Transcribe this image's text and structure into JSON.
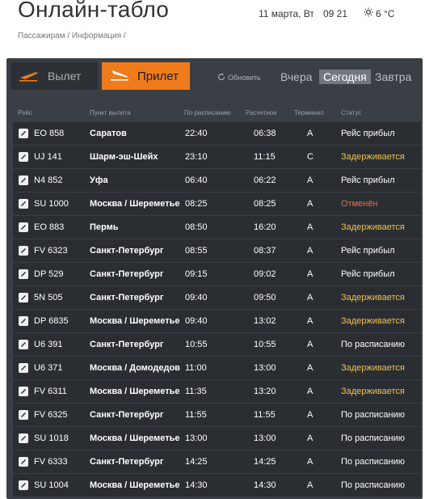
{
  "header": {
    "title": "Онлайн-табло",
    "date": "11 марта, Вт",
    "time": "09 21",
    "weather": "6 °C",
    "breadcrumb": "Пассажирам / Информация /"
  },
  "tabs": {
    "departure": "Вылет",
    "arrival": "Прилет",
    "refresh": "Обновить",
    "yesterday": "Вчера",
    "today": "Сегодня",
    "tomorrow": "Завтра"
  },
  "columns": {
    "flight": "Рейс",
    "origin": "Пункт вылета",
    "scheduled": "По расписанию",
    "estimated": "Расчетное",
    "terminal": "Терминал",
    "status": "Статус"
  },
  "flights": [
    {
      "flight": "EO 858",
      "origin": "Саратов",
      "scheduled": "22:40",
      "estimated": "06:38",
      "terminal": "A",
      "status": "Рейс прибыл",
      "status_type": "arrived",
      "icon": "airline-logo-icon"
    },
    {
      "flight": "UJ 141",
      "origin": "Шарм-эш-Шейх",
      "scheduled": "23:10",
      "estimated": "11:15",
      "terminal": "C",
      "status": "Задерживается",
      "status_type": "delayed",
      "icon": "airline-logo-icon"
    },
    {
      "flight": "N4 852",
      "origin": "Уфа",
      "scheduled": "06:40",
      "estimated": "06:22",
      "terminal": "A",
      "status": "Рейс прибыл",
      "status_type": "arrived",
      "icon": "airline-logo-icon"
    },
    {
      "flight": "SU 1000",
      "origin": "Москва / Шереметьево",
      "scheduled": "08:25",
      "estimated": "08:25",
      "terminal": "A",
      "status": "Отменён",
      "status_type": "cancel",
      "icon": "airline-logo-icon"
    },
    {
      "flight": "EO 883",
      "origin": "Пермь",
      "scheduled": "08:50",
      "estimated": "16:20",
      "terminal": "A",
      "status": "Задерживается",
      "status_type": "delayed",
      "icon": "airline-logo-icon"
    },
    {
      "flight": "FV 6323",
      "origin": "Санкт-Петербург",
      "scheduled": "08:55",
      "estimated": "08:37",
      "terminal": "A",
      "status": "Рейс прибыл",
      "status_type": "arrived",
      "icon": "airline-logo-icon"
    },
    {
      "flight": "DP 529",
      "origin": "Санкт-Петербург",
      "scheduled": "09:15",
      "estimated": "09:02",
      "terminal": "A",
      "status": "Рейс прибыл",
      "status_type": "arrived",
      "icon": "airline-logo-icon"
    },
    {
      "flight": "5N 505",
      "origin": "Санкт-Петербург",
      "scheduled": "09:40",
      "estimated": "09:50",
      "terminal": "A",
      "status": "Задерживается",
      "status_type": "delayed",
      "icon": "airline-logo-icon"
    },
    {
      "flight": "DP 6835",
      "origin": "Москва / Шереметьево",
      "scheduled": "09:40",
      "estimated": "13:02",
      "terminal": "A",
      "status": "Задерживается",
      "status_type": "delayed",
      "icon": "airline-logo-icon"
    },
    {
      "flight": "U6 391",
      "origin": "Санкт-Петербург",
      "scheduled": "10:55",
      "estimated": "10:55",
      "terminal": "A",
      "status": "По расписанию",
      "status_type": "sched",
      "icon": "airline-logo-icon"
    },
    {
      "flight": "U6 371",
      "origin": "Москва / Домодедово",
      "scheduled": "11:00",
      "estimated": "13:00",
      "terminal": "A",
      "status": "Задерживается",
      "status_type": "delayed",
      "icon": "airline-logo-icon"
    },
    {
      "flight": "FV 6311",
      "origin": "Москва / Шереметьево",
      "scheduled": "11:35",
      "estimated": "13:20",
      "terminal": "A",
      "status": "Задерживается",
      "status_type": "delayed",
      "icon": "airline-logo-icon"
    },
    {
      "flight": "FV 6325",
      "origin": "Санкт-Петербург",
      "scheduled": "11:55",
      "estimated": "11:55",
      "terminal": "A",
      "status": "По расписанию",
      "status_type": "sched",
      "icon": "airline-logo-icon"
    },
    {
      "flight": "SU 1018",
      "origin": "Москва / Шереметьево",
      "scheduled": "13:00",
      "estimated": "13:00",
      "terminal": "A",
      "status": "По расписанию",
      "status_type": "sched",
      "icon": "airline-logo-icon"
    },
    {
      "flight": "FV 6333",
      "origin": "Санкт-Петербург",
      "scheduled": "14:25",
      "estimated": "14:25",
      "terminal": "A",
      "status": "По расписанию",
      "status_type": "sched",
      "icon": "airline-logo-icon"
    },
    {
      "flight": "SU 1004",
      "origin": "Москва / Шереметьево",
      "scheduled": "14:30",
      "estimated": "14:30",
      "terminal": "A",
      "status": "По расписанию",
      "status_type": "sched",
      "icon": "airline-logo-icon"
    }
  ],
  "colors": {
    "accent": "#f07b1c",
    "board_bg": "#3a3f45",
    "row_bg": "#2a2e33",
    "delayed": "#f0c24a",
    "cancelled": "#e56b53"
  }
}
